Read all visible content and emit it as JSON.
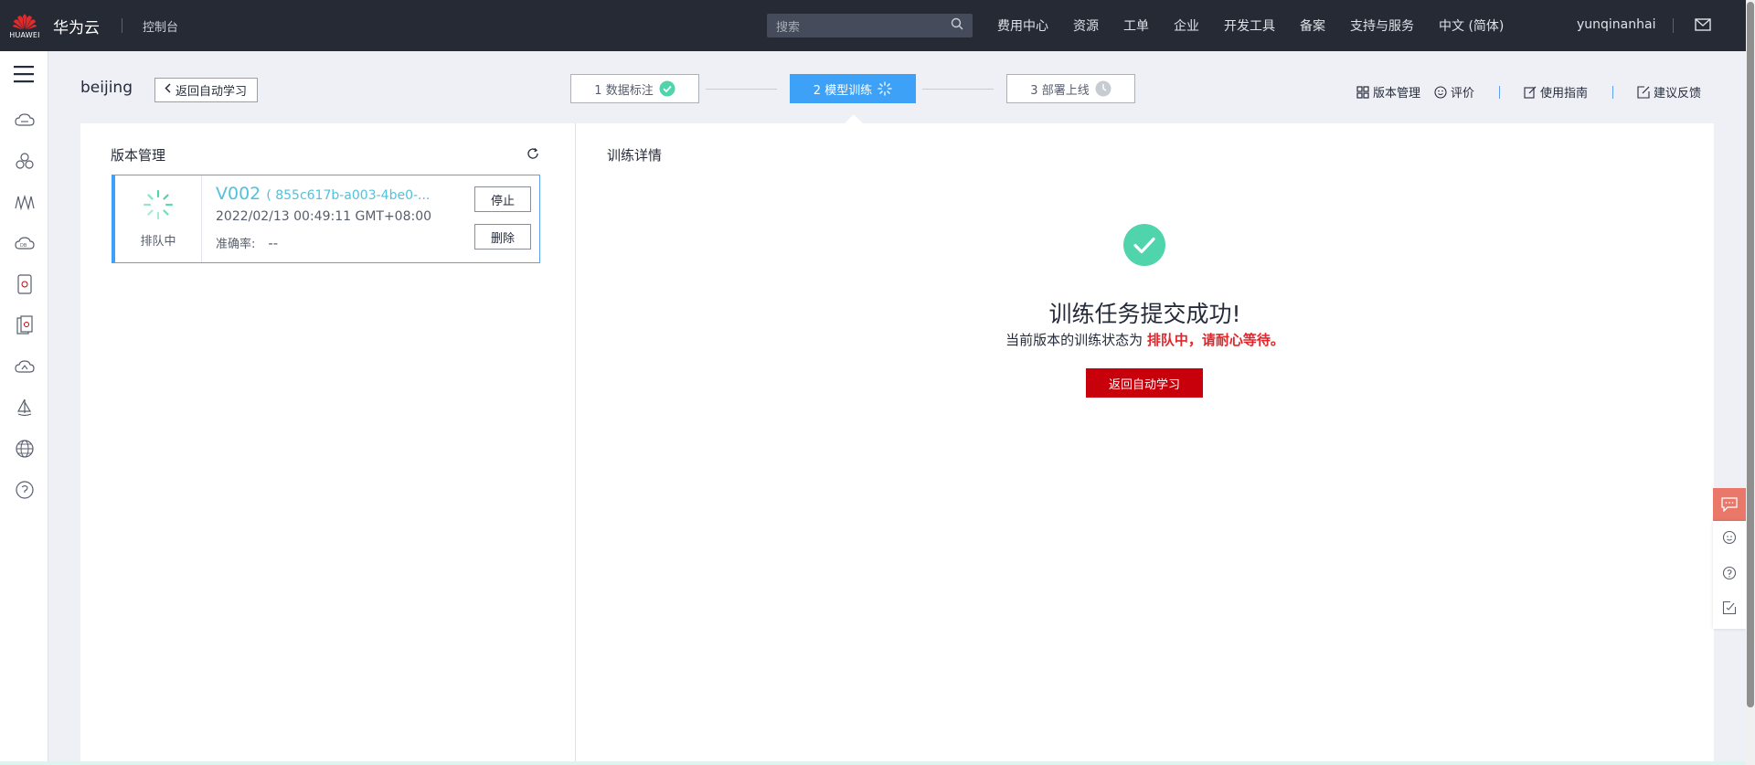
{
  "topbar": {
    "logo_word": "HUAWEI",
    "brand": "华为云",
    "console": "控制台",
    "search_placeholder": "搜索",
    "nav": [
      "费用中心",
      "资源",
      "工单",
      "企业",
      "开发工具",
      "备案",
      "支持与服务",
      "中文 (简体)"
    ],
    "username": "yunqinanhai"
  },
  "header": {
    "region": "beijing",
    "back_label": "返回自动学习",
    "steps": [
      {
        "label": "1 数据标注",
        "state": "done"
      },
      {
        "label": "2 模型训练",
        "state": "active"
      },
      {
        "label": "3 部署上线",
        "state": "pending"
      }
    ],
    "links": [
      "版本管理",
      "评价",
      "使用指南",
      "建议反馈"
    ]
  },
  "version_panel": {
    "title": "版本管理",
    "card": {
      "status": "排队中",
      "version": "V002",
      "id_text": "( 855c617b-a003-4be0-...",
      "time": "2022/02/13 00:49:11 GMT+08:00",
      "accuracy_label": "准确率:",
      "accuracy_value": "--",
      "stop_label": "停止",
      "delete_label": "删除"
    }
  },
  "training_detail": {
    "title": "训练详情",
    "success_title": "训练任务提交成功!",
    "success_sub_prefix": "当前版本的训练状态为",
    "success_sub_highlight": "排队中，请耐心等待。",
    "back_button": "返回自动学习"
  },
  "colors": {
    "topbar": "#252a35",
    "accent_blue": "#3ca1f7",
    "primary_red": "#c7000b",
    "success_green": "#50d4ab",
    "highlight_red": "#e2262b",
    "version_teal": "#51c1dc"
  },
  "icons": {
    "sidebar": [
      "cloud-monitor-icon",
      "cluster-icon",
      "waveform-icon",
      "cloud-db-icon",
      "device-icon",
      "document-icon",
      "cloud-sync-icon",
      "sailboat-icon",
      "globe-icon",
      "support-icon"
    ]
  }
}
